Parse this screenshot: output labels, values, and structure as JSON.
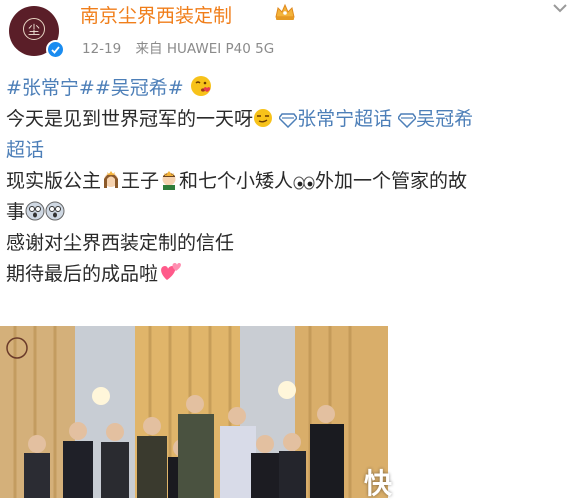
{
  "header": {
    "username": "南京尘界西装定制",
    "date": "12-19",
    "source": "来自 HUAWEI P40 5G",
    "avatar_icon": "brand-seal-avatar",
    "verified_icon": "verified-badge-icon",
    "crown_icon": "crown-icon"
  },
  "post": {
    "hashtag_1": "#张常宁#",
    "hashtag_2": "#吴冠希#",
    "line2_text": "今天是见到世界冠军的一天呀",
    "supertopic_1": "张常宁超话",
    "supertopic_2": "吴冠希",
    "supertopic_2_cont": "超话",
    "line4_a": "现实版公主",
    "line4_b": "王子",
    "line4_c": "和七个小矮人",
    "line4_d": "外加一个管家的故",
    "line5_text": "事",
    "line6_text": "感谢对尘界西装定制的信任",
    "line7_text": "期待最后的成品啦"
  },
  "photo": {
    "description_icon": "group-photo-image",
    "watermark": "快"
  },
  "colors": {
    "username": "#f07e1a",
    "link": "#4d7fb8",
    "meta": "#8b8b8b",
    "verified": "#1a8cf0"
  }
}
